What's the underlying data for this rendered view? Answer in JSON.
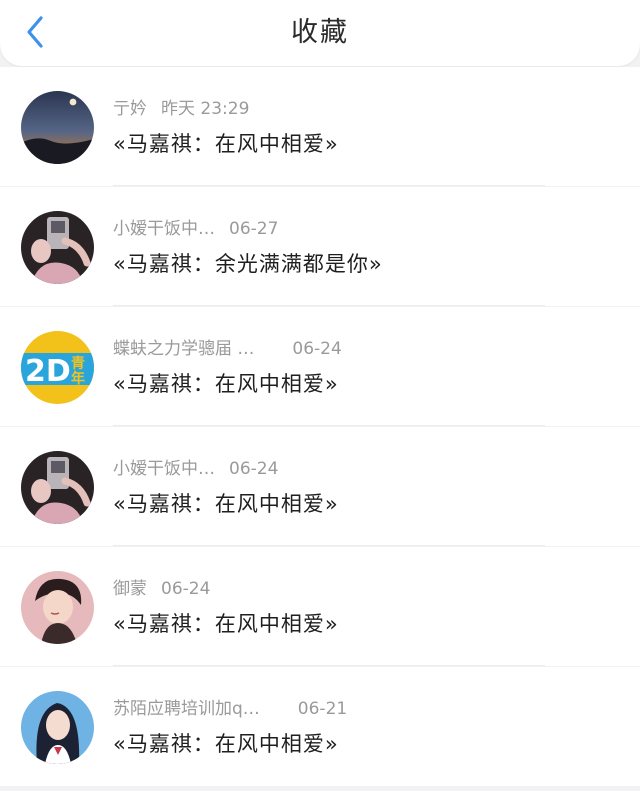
{
  "header": {
    "title": "收藏",
    "back_icon": "chevron-left-icon",
    "accent_color": "#3d8ff0"
  },
  "items": [
    {
      "name": "亍妗",
      "time": "昨天 23:29",
      "content": "«马嘉祺：在风中相爱»",
      "avatar_icon": "night-sky-avatar"
    },
    {
      "name": "小嫒干饭中…",
      "time": "06-27",
      "content": "«马嘉祺：余光满满都是你»",
      "avatar_icon": "person-photo-avatar"
    },
    {
      "name": "蝶蚨之力学骢届 …",
      "time": "06-24",
      "content": "«马嘉祺：在风中相爱»",
      "avatar_icon": "2d-logo-avatar"
    },
    {
      "name": "小嫒干饭中…",
      "time": "06-24",
      "content": "«马嘉祺：在风中相爱»",
      "avatar_icon": "person-photo-avatar"
    },
    {
      "name": "御蒙",
      "time": "06-24",
      "content": "«马嘉祺：在风中相爱»",
      "avatar_icon": "anime-boy-avatar"
    },
    {
      "name": "苏陌应聘培训加q…",
      "time": "06-21",
      "content": "«马嘉祺：在风中相爱»",
      "avatar_icon": "anime-girl-avatar"
    }
  ]
}
